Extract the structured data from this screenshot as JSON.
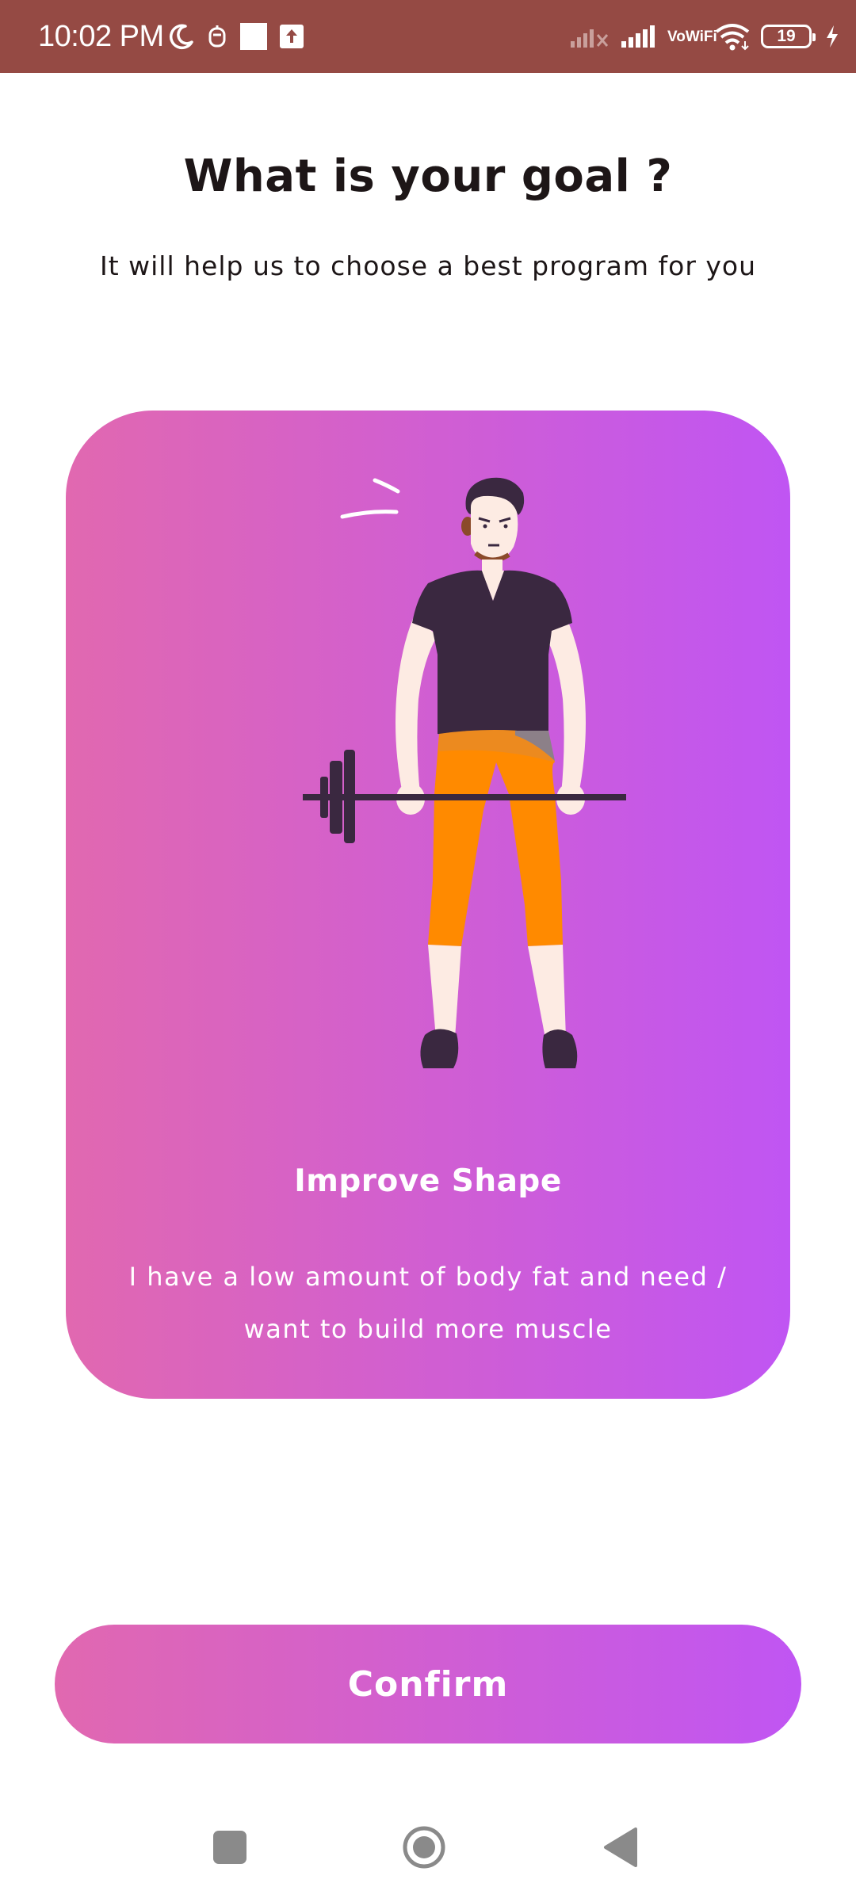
{
  "status_bar": {
    "time": "10:02 PM",
    "vowifi_top": "Vo",
    "vowifi_bottom": "WiFi",
    "battery": "19",
    "background_color": "#954a44"
  },
  "header": {
    "title": "What is your goal ?",
    "subtitle": "It will help us to choose a best program for you"
  },
  "goal_card": {
    "title": "Improve Shape",
    "description": "I have a low amount of body fat and need / want to build more muscle",
    "gradient_start": "#e168b0",
    "gradient_end": "#c055f3"
  },
  "actions": {
    "confirm_label": "Confirm"
  },
  "icons": {
    "status_left": [
      "moon-icon",
      "notification-icon",
      "square-icon",
      "upload-icon"
    ],
    "status_right": [
      "signal-no-service-icon",
      "signal-icon",
      "vowifi-icon",
      "wifi-icon",
      "battery-icon",
      "charging-icon"
    ],
    "nav": [
      "recents-icon",
      "home-icon",
      "back-icon"
    ]
  }
}
